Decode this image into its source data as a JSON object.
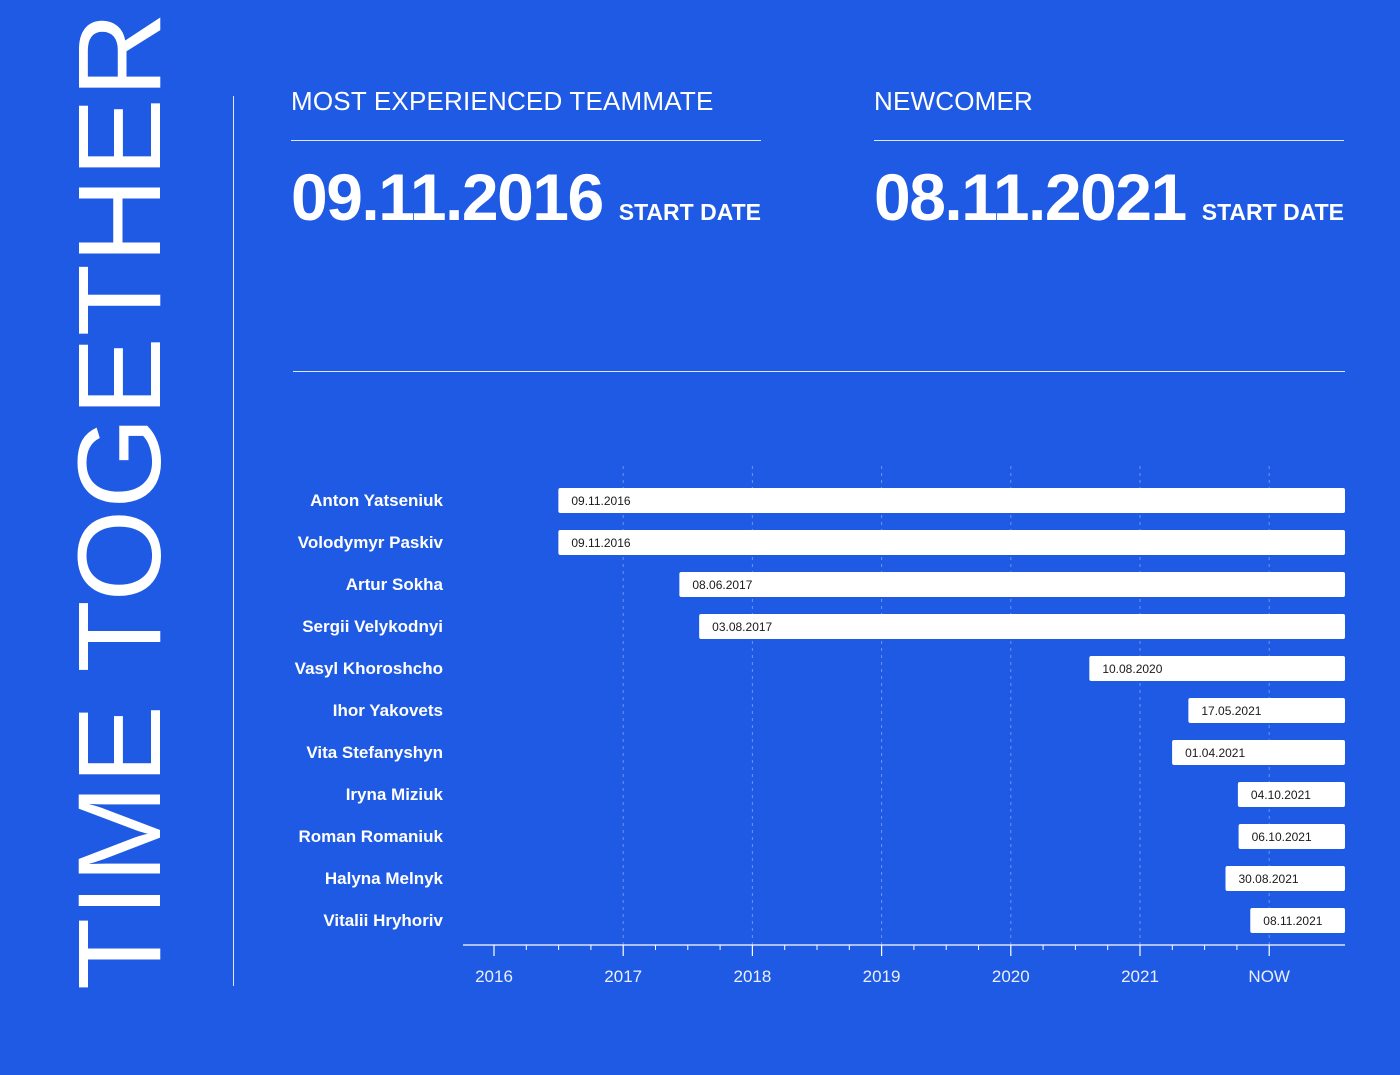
{
  "title": "TIME TOGETHER",
  "stats": {
    "experienced": {
      "label": "MOST EXPERIENCED TEAMMATE",
      "date": "09.11.2016",
      "caption": "START DATE"
    },
    "newcomer": {
      "label": "NEWCOMER",
      "date": "08.11.2021",
      "caption": "START DATE"
    }
  },
  "colors": {
    "background": "#1f5ae5",
    "foreground": "#ffffff",
    "bar_text": "#1a1a1a"
  },
  "chart_data": {
    "type": "bar",
    "orientation": "horizontal",
    "x_ticks": [
      "2016",
      "2017",
      "2018",
      "2019",
      "2020",
      "2021",
      "NOW"
    ],
    "xlim": [
      "2016-01-01",
      "2022-09-01"
    ],
    "grid": true,
    "rows": [
      {
        "name": "Anton Yatseniuk",
        "start": "2016-07-01",
        "label": "09.11.2016"
      },
      {
        "name": "Volodymyr Paskiv",
        "start": "2016-07-01",
        "label": "09.11.2016"
      },
      {
        "name": "Artur Sokha",
        "start": "2017-06-08",
        "label": "08.06.2017"
      },
      {
        "name": "Sergii Velykodnyi",
        "start": "2017-08-03",
        "label": "03.08.2017"
      },
      {
        "name": "Vasyl Khoroshcho",
        "start": "2020-08-10",
        "label": "10.08.2020"
      },
      {
        "name": "Ihor Yakovets",
        "start": "2021-05-17",
        "label": "17.05.2021"
      },
      {
        "name": "Vita Stefanyshyn",
        "start": "2021-04-01",
        "label": "01.04.2021"
      },
      {
        "name": "Iryna Miziuk",
        "start": "2021-10-04",
        "label": "04.10.2021"
      },
      {
        "name": "Roman Romaniuk",
        "start": "2021-10-06",
        "label": "06.10.2021"
      },
      {
        "name": "Halyna Melnyk",
        "start": "2021-08-30",
        "label": "30.08.2021"
      },
      {
        "name": "Vitalii Hryhoriv",
        "start": "2021-11-08",
        "label": "08.11.2021"
      }
    ]
  }
}
